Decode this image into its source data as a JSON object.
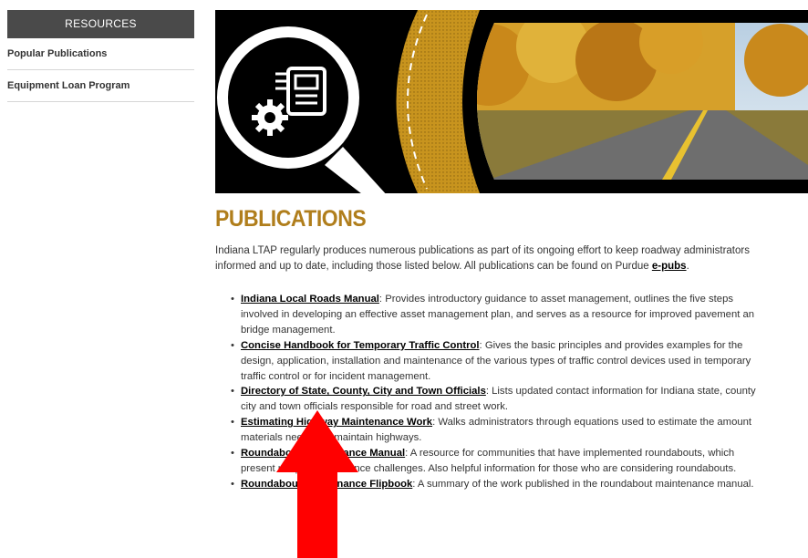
{
  "sidebar": {
    "header": "RESOURCES",
    "items": [
      {
        "label": "Popular Publications"
      },
      {
        "label": "Equipment Loan Program"
      }
    ]
  },
  "banner": {
    "icon": "publication-gear-icon",
    "photo": "autumn-road-photo"
  },
  "main": {
    "title": "PUBLICATIONS",
    "intro_line1": "Indiana LTAP regularly produces numerous publications as part of its ongoing effort to keep roadway administrators",
    "intro_line2_prefix": "informed and up to date, including those listed below. All publications can be found on Purdue ",
    "intro_link": "e-pubs",
    "intro_line2_suffix": ".",
    "publications": [
      {
        "title": "Indiana Local Roads Manual",
        "line1": ": Provides introductory guidance to asset management, outlines the five steps",
        "line2": "involved in developing an effective asset management plan, and serves as a resource for improved pavement an",
        "line3": "bridge management."
      },
      {
        "title": "Concise Handbook for Temporary Traffic Control",
        "line1": ": Gives the basic principles and provides examples for the",
        "line2": "design, application, installation and maintenance of the various types of traffic control devices used in temporary",
        "line3": "traffic control or for incident management."
      },
      {
        "title": "Directory of State, County, City and Town Officials",
        "line1": ": Lists updated contact information for Indiana state, county",
        "line2": "city and town officials responsible for road and street work."
      },
      {
        "title": "Estimating Highway Maintenance Work",
        "line1": ": Walks administrators through equations used to estimate the amount",
        "line2": "materials needed to maintain highways."
      },
      {
        "title": "Roundabout Maintenance Manual",
        "line1": ": A resource for communities that have implemented roundabouts, which",
        "line2": "present unique maintenance challenges. Also helpful information for those who are considering roundabouts."
      },
      {
        "title": "Roundabout Maintenance Flipbook",
        "line1": ": A summary of the work published in the roundabout maintenance manual."
      }
    ]
  },
  "overlay": {
    "icon": "red-arrow-up-icon",
    "color": "#ff0000"
  },
  "colors": {
    "sidebar_header_bg": "#4a4a4a",
    "title": "#b07e1c",
    "banner_gold": "#c8941e"
  }
}
